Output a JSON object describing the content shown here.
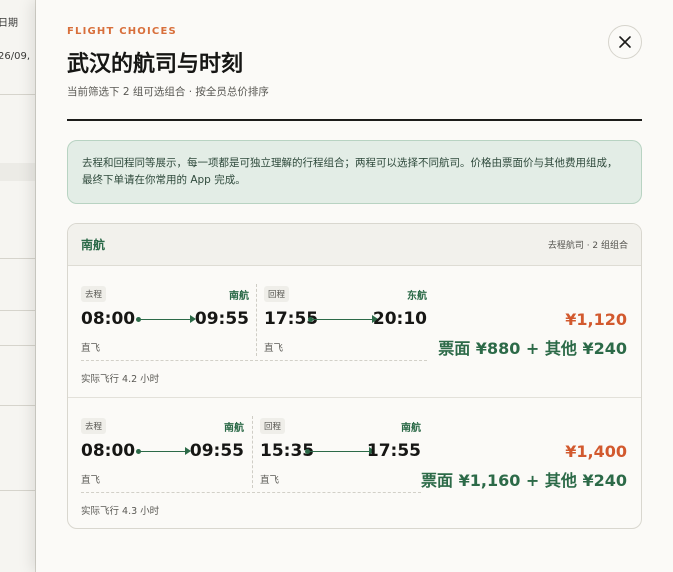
{
  "background": {
    "col_header": "日期",
    "date_fragment": "26/09,"
  },
  "panel": {
    "kicker": "FLIGHT CHOICES",
    "title": "武汉的航司与时刻",
    "subtitle": "当前筛选下 2 组可选组合 · 按全员总价排序",
    "close_icon": "close-icon",
    "notice": "去程和回程同等展示，每一项都是可独立理解的行程组合；两程可以选择不同航司。价格由票面价与其他费用组成，最终下单请在你常用的 App 完成。"
  },
  "group": {
    "airline": "南航",
    "meta": "去程航司 · 2 组组合",
    "options": [
      {
        "outbound": {
          "tag": "去程",
          "airline": "南航",
          "depart": "08:00",
          "arrive": "09:55",
          "stops": "直飞"
        },
        "inbound": {
          "tag": "回程",
          "airline": "东航",
          "depart": "17:55",
          "arrive": "20:10",
          "stops": "直飞"
        },
        "duration": "实际飞行 4.2 小时",
        "total": "¥1,120",
        "breakdown": "票面 ¥880 + 其他 ¥240"
      },
      {
        "outbound": {
          "tag": "去程",
          "airline": "南航",
          "depart": "08:00",
          "arrive": "09:55",
          "stops": "直飞"
        },
        "inbound": {
          "tag": "回程",
          "airline": "南航",
          "depart": "15:35",
          "arrive": "17:55",
          "stops": "直飞"
        },
        "duration": "实际飞行 4.3 小时",
        "total": "¥1,400",
        "breakdown": "票面 ¥1,160 + 其他 ¥240"
      }
    ]
  },
  "colors": {
    "accent_orange": "#d86f3b",
    "price_orange": "#d2592e",
    "brand_green": "#2c6a48",
    "notice_bg": "#e3ede6"
  }
}
